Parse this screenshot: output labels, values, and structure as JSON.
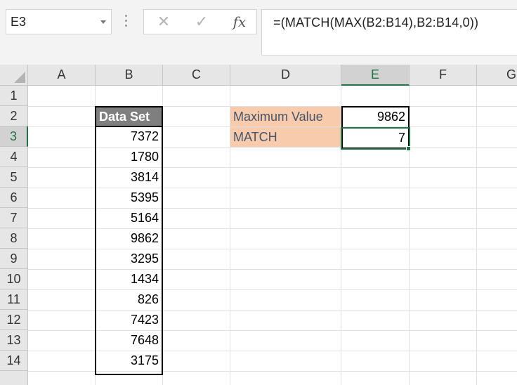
{
  "name_box": {
    "value": "E3"
  },
  "formula_bar": {
    "cancel_glyph": "✕",
    "enter_glyph": "✓",
    "fx_label": "fx",
    "formula": "=(MATCH(MAX(B2:B14),B2:B14,0))"
  },
  "columns": [
    "A",
    "B",
    "C",
    "D",
    "E",
    "F",
    "G"
  ],
  "rows": [
    "1",
    "2",
    "3",
    "4",
    "5",
    "6",
    "7",
    "8",
    "9",
    "10",
    "11",
    "12",
    "13",
    "14"
  ],
  "data_set": {
    "header": "Data Set",
    "values": [
      "7372",
      "1780",
      "3814",
      "5395",
      "5164",
      "9862",
      "3295",
      "1434",
      "826",
      "7423",
      "7648",
      "3175"
    ]
  },
  "results": {
    "max_label": "Maximum Value",
    "max_value": "9862",
    "match_label": "MATCH",
    "match_value": "7"
  },
  "colors": {
    "header_fill": "#7f7f7f",
    "label_fill": "#f8cbad",
    "selection": "#217346"
  },
  "selected_cell": "E3"
}
